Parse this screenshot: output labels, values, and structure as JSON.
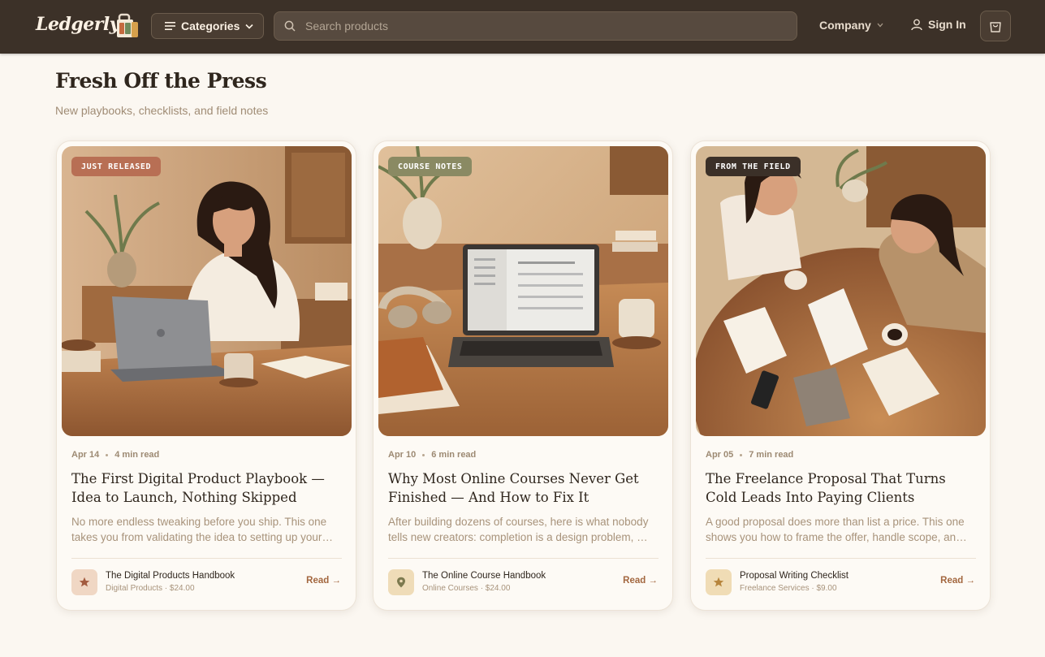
{
  "header": {
    "logo": "Ledgerly",
    "categories_label": "Categories",
    "search_placeholder": "Search products",
    "company_label": "Company",
    "signin_label": "Sign In"
  },
  "section": {
    "title": "Fresh Off the Press",
    "subtitle": "New playbooks, checklists, and field notes"
  },
  "cards": [
    {
      "badge": "JUST RELEASED",
      "badge_color": "#b86f54",
      "date": "Apr 14",
      "read_time": "4 min read",
      "title": "The First Digital Product Playbook — Idea to Launch, Nothing Skipped",
      "excerpt": "No more endless tweaking before you ship. This one takes you from validating the idea to setting up your storefront and launching.",
      "product_name": "The Digital Products Handbook",
      "product_meta": "Digital Products · $24.00",
      "product_icon": "star-icon",
      "product_icon_bg": "#f0d7c4",
      "read_label": "Read →"
    },
    {
      "badge": "COURSE NOTES",
      "badge_color": "#8a8a63",
      "date": "Apr 10",
      "read_time": "6 min read",
      "title": "Why Most Online Courses Never Get Finished — And How to Fix It",
      "excerpt": "After building dozens of courses, here is what nobody tells new creators: completion is a design problem, not a motivation problem.",
      "product_name": "The Online Course Handbook",
      "product_meta": "Online Courses · $24.00",
      "product_icon": "map-pin-icon",
      "product_icon_bg": "#efdcb8",
      "read_label": "Read →"
    },
    {
      "badge": "FROM THE FIELD",
      "badge_color": "#3b3028",
      "date": "Apr 05",
      "read_time": "7 min read",
      "title": "The Freelance Proposal That Turns Cold Leads Into Paying Clients",
      "excerpt": "A good proposal does more than list a price. This one shows you how to frame the offer, handle scope, and close the deal.",
      "product_name": "Proposal Writing Checklist",
      "product_meta": "Freelance Services · $9.00",
      "product_icon": "star-icon",
      "product_icon_bg": "#f0dcb5",
      "read_label": "Read →"
    }
  ]
}
